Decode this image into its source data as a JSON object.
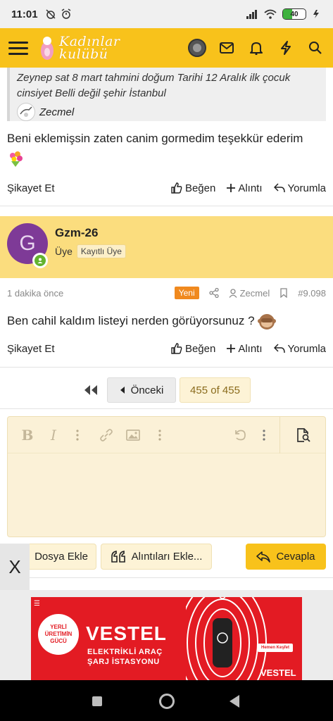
{
  "status_bar": {
    "time": "11:01",
    "battery": "40"
  },
  "header": {
    "logo_line1": "Kadınlar",
    "logo_line2": "kulübü"
  },
  "quote": {
    "text": "Zeynep sat 8 mart tahmini doğum Tarihi 12 Aralık ilk çocuk cinsiyet Belli değil şehir İstanbul",
    "author": "Zecmel"
  },
  "post1": {
    "text": "Beni eklemişsin zaten canim gormedim teşekkür ederim",
    "actions": {
      "report": "Şikayet Et",
      "like": "Beğen",
      "quote": "Alıntı",
      "reply": "Yorumla"
    }
  },
  "post2": {
    "avatar_letter": "G",
    "username": "Gzm-26",
    "role": "Üye",
    "badge": "Kayıtlı Üye",
    "time": "1 dakika önce",
    "new_badge": "Yeni",
    "mention": "Zecmel",
    "post_number": "#9.098",
    "text": "Ben cahil kaldım listeyi nerden görüyorsunuz ?",
    "actions": {
      "report": "Şikayet Et",
      "like": "Beğen",
      "quote": "Alıntı",
      "reply": "Yorumla"
    }
  },
  "pagination": {
    "prev": "Önceki",
    "count": "455 of 455"
  },
  "editor": {
    "bold": "B",
    "italic": "I",
    "buttons": {
      "attach": "Dosya Ekle",
      "insert_quotes": "Alıntıları Ekle...",
      "reply": "Cevapla"
    }
  },
  "ad": {
    "close": "X",
    "badge": "YERLİ ÜRETİMİN GÜCÜ",
    "brand": "VESTEL",
    "line1": "ELEKTRİKLİ ARAÇ",
    "line2": "ŞARJ İSTASYONU",
    "cta": "Hemen Keşfet",
    "logo": "VESTEL"
  }
}
